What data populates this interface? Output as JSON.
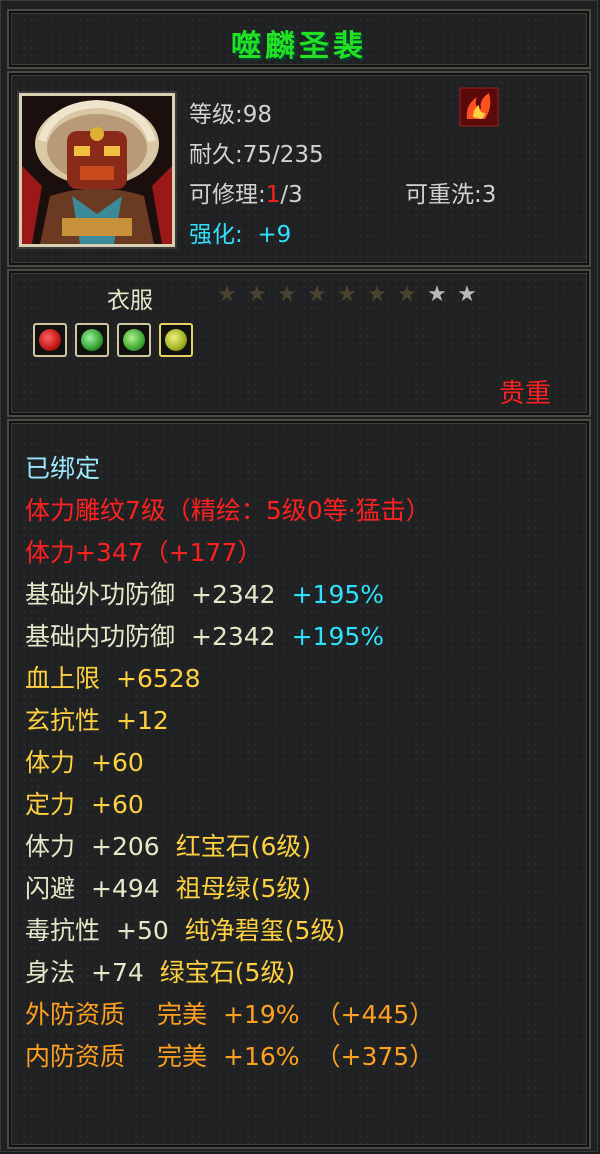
{
  "title": "噬麟圣裴",
  "info": {
    "level": "等级:98",
    "durability": "耐久:75/235",
    "repair_label": "可修理:",
    "repair_current": "1",
    "repair_total": "/3",
    "rewash": "可重洗:3",
    "enhance_label": "强化:",
    "enhance_value": "+9"
  },
  "item_type": "衣服",
  "stars": {
    "filled": 7,
    "total": 9
  },
  "gems": [
    "red-gem-icon",
    "green-gem-icon",
    "green-gem-icon",
    "yellow-green-gem-icon"
  ],
  "rarity": "贵重",
  "bound": "已绑定",
  "engraving": "体力雕纹7级（精绘：5级0等·猛击）",
  "attributes": [
    {
      "name": "体力",
      "value": "+347",
      "extra": "（+177）"
    },
    {
      "name": "基础外功防御",
      "value": "+2342",
      "extra": "+195%"
    },
    {
      "name": "基础内功防御",
      "value": "+2342",
      "extra": "+195%"
    },
    {
      "name": "血上限",
      "value": "+6528"
    },
    {
      "name": "玄抗性",
      "value": "+12"
    },
    {
      "name": "体力",
      "value": "+60"
    },
    {
      "name": "定力",
      "value": "+60"
    },
    {
      "name": "体力",
      "value": "+206",
      "gem": "红宝石(6级)"
    },
    {
      "name": "闪避",
      "value": "+494",
      "gem": "祖母绿(5级)"
    },
    {
      "name": "毒抗性",
      "value": "+50",
      "gem": "纯净碧玺(5级)"
    },
    {
      "name": "身法",
      "value": "+74",
      "gem": "绿宝石(5级)"
    },
    {
      "name": "外防资质",
      "value": "完美",
      "pct": "+19%",
      "bonus": "（+445）"
    },
    {
      "name": "内防资质",
      "value": "完美",
      "pct": "+16%",
      "bonus": "（+375）"
    }
  ],
  "colors": {
    "title": "#22e022",
    "rarity": "#ff2020",
    "cyan": "#30e0ff",
    "orange": "#ffa020"
  }
}
